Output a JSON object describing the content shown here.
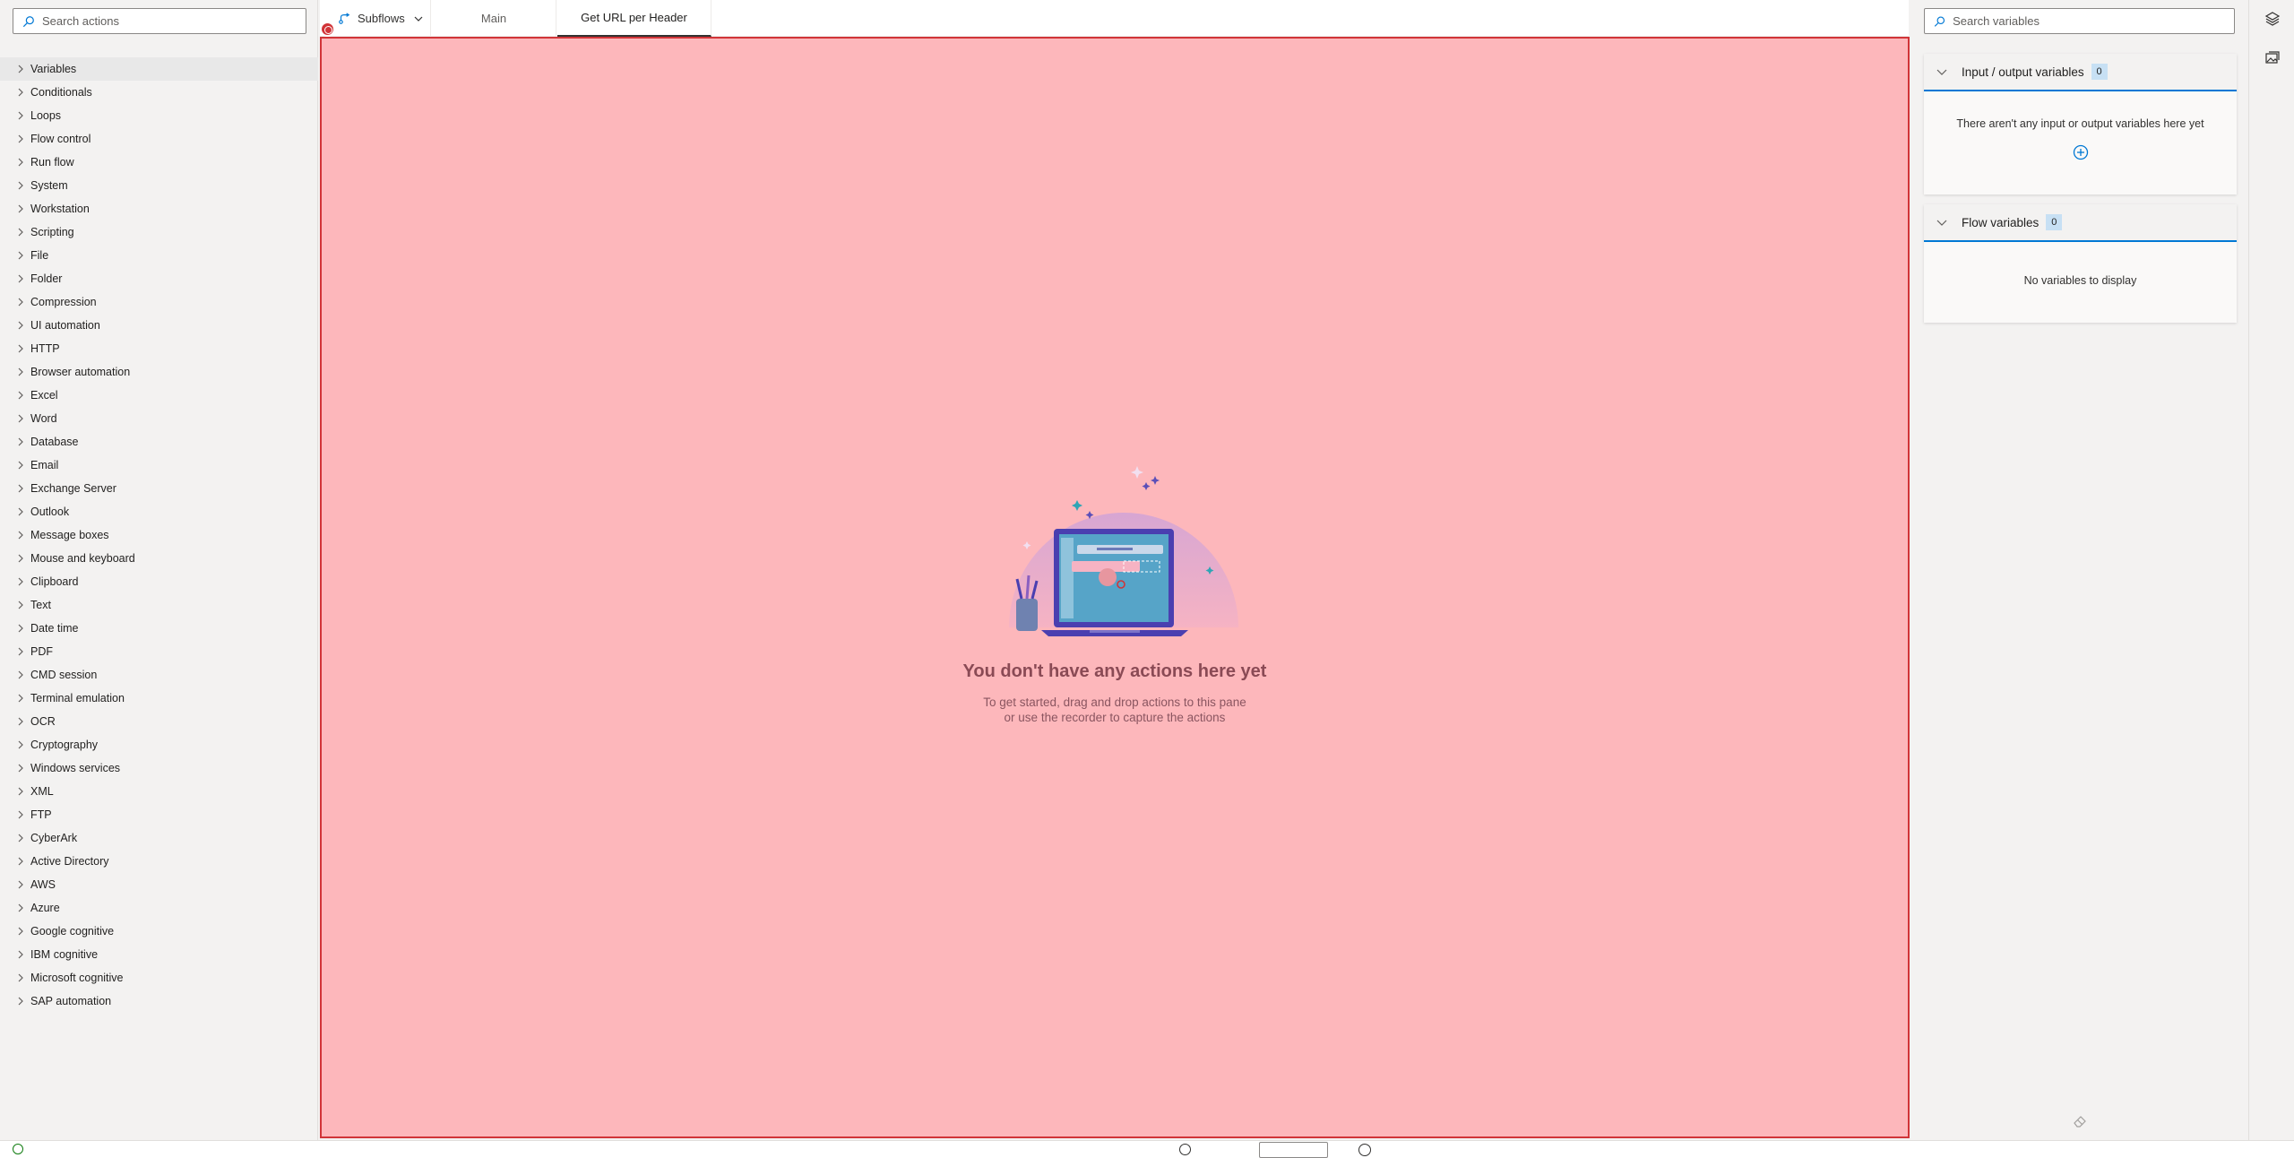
{
  "actions_pane": {
    "search_placeholder": "Search actions",
    "items": [
      {
        "label": "Variables"
      },
      {
        "label": "Conditionals"
      },
      {
        "label": "Loops"
      },
      {
        "label": "Flow control"
      },
      {
        "label": "Run flow"
      },
      {
        "label": "System"
      },
      {
        "label": "Workstation"
      },
      {
        "label": "Scripting"
      },
      {
        "label": "File"
      },
      {
        "label": "Folder"
      },
      {
        "label": "Compression"
      },
      {
        "label": "UI automation"
      },
      {
        "label": "HTTP"
      },
      {
        "label": "Browser automation"
      },
      {
        "label": "Excel"
      },
      {
        "label": "Word"
      },
      {
        "label": "Database"
      },
      {
        "label": "Email"
      },
      {
        "label": "Exchange Server"
      },
      {
        "label": "Outlook"
      },
      {
        "label": "Message boxes"
      },
      {
        "label": "Mouse and keyboard"
      },
      {
        "label": "Clipboard"
      },
      {
        "label": "Text"
      },
      {
        "label": "Date time"
      },
      {
        "label": "PDF"
      },
      {
        "label": "CMD session"
      },
      {
        "label": "Terminal emulation"
      },
      {
        "label": "OCR"
      },
      {
        "label": "Cryptography"
      },
      {
        "label": "Windows services"
      },
      {
        "label": "XML"
      },
      {
        "label": "FTP"
      },
      {
        "label": "CyberArk"
      },
      {
        "label": "Active Directory"
      },
      {
        "label": "AWS"
      },
      {
        "label": "Azure"
      },
      {
        "label": "Google cognitive"
      },
      {
        "label": "IBM cognitive"
      },
      {
        "label": "Microsoft cognitive"
      },
      {
        "label": "SAP automation"
      }
    ]
  },
  "tabs": {
    "subflows_label": "Subflows",
    "main_label": "Main",
    "active_label": "Get URL per Header"
  },
  "canvas": {
    "empty_title": "You don't have any actions here yet",
    "empty_line1": "To get started, drag and drop actions to this pane",
    "empty_line2": "or use the recorder to capture the actions"
  },
  "variables_pane": {
    "search_placeholder": "Search variables",
    "io_title": "Input / output variables",
    "io_count": "0",
    "io_empty": "There aren't any input or output variables here yet",
    "flow_title": "Flow variables",
    "flow_count": "0",
    "flow_empty": "No variables to display"
  },
  "icons": {
    "search": "search-icon",
    "chevron": "chevron-right-icon",
    "subflows": "subflows-icon",
    "add": "add-circle-icon",
    "eraser": "eraser-icon",
    "layers": "layers-icon",
    "images": "images-icon"
  },
  "colors": {
    "canvas_bg": "#fdb7bb",
    "canvas_border": "#d13438",
    "accent": "#0078d4"
  }
}
